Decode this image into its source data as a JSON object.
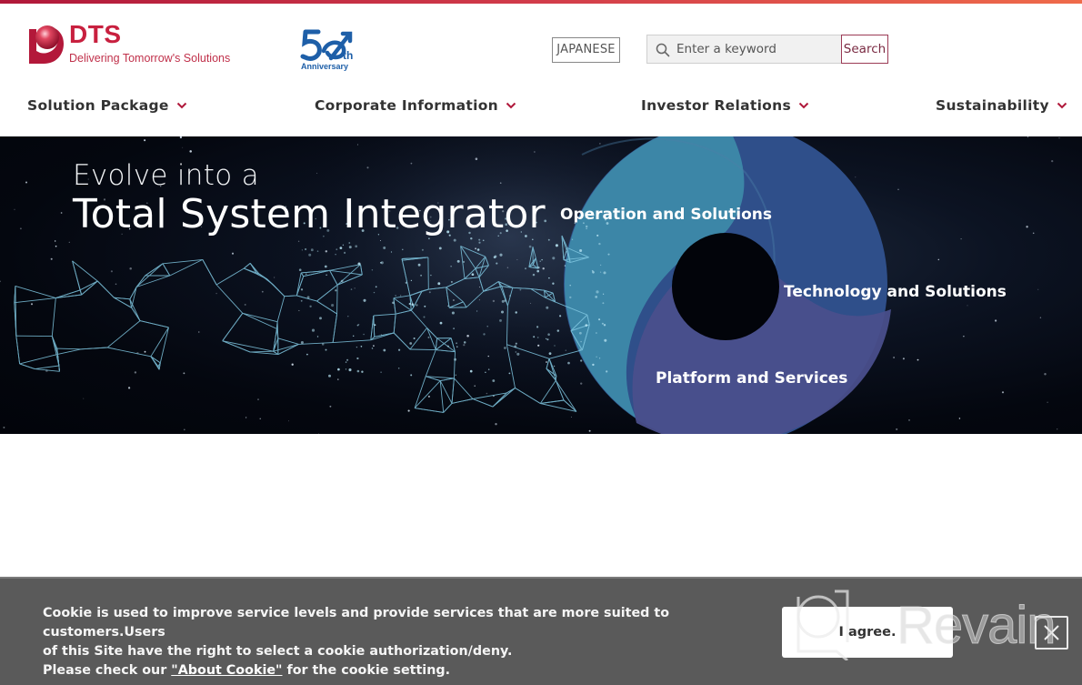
{
  "brand": {
    "name": "DTS",
    "tagline": "Delivering Tomorrow's Solutions",
    "anniversary_number": "50",
    "anniversary_suffix": "th",
    "anniversary_label": "Anniversary",
    "colors": {
      "primary": "#c8203f",
      "anniversary": "#1e5fa8",
      "topbar_start": "#b0183a",
      "topbar_end": "#ef6b4a"
    }
  },
  "header": {
    "language_button": "JAPANESE",
    "search": {
      "placeholder": "Enter a keyword",
      "value": "",
      "button_label": "Search",
      "icon": "search-icon"
    }
  },
  "nav": {
    "items": [
      {
        "label": "Solution Package",
        "icon": "chevron-down-icon"
      },
      {
        "label": "Corporate Information",
        "icon": "chevron-down-icon"
      },
      {
        "label": "Investor Relations",
        "icon": "chevron-down-icon"
      },
      {
        "label": "Sustainability",
        "icon": "chevron-down-icon"
      }
    ]
  },
  "hero": {
    "line1": "Evolve into a",
    "line2": "Total System Integrator",
    "segments": [
      {
        "label": "Operation and Solutions",
        "color": "#3d89a9"
      },
      {
        "label": "Technology and Solutions",
        "color": "#2f4f8a"
      },
      {
        "label": "Platform and Services",
        "color": "#4a4f8c"
      }
    ]
  },
  "cookie": {
    "text_line1": "Cookie is used to improve service levels and provide services that are more suited to customers.Users",
    "text_line2": "of this Site have the right to select a cookie authorization/deny.",
    "text_prefix": "Please check our ",
    "link_label": "\"About Cookie\"",
    "text_suffix": " for the cookie setting.",
    "agree_label": "I agree.",
    "close_icon": "close-icon"
  },
  "watermark": {
    "text": "Revain"
  }
}
